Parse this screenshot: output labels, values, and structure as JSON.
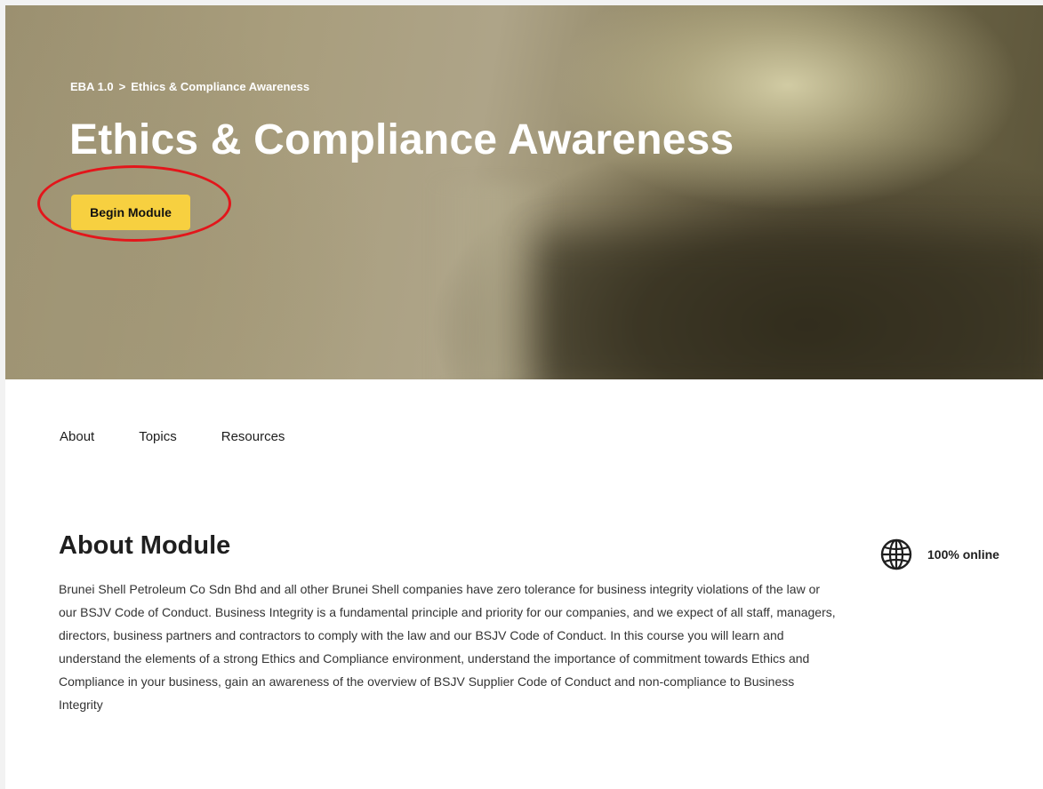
{
  "breadcrumb": {
    "root": "EBA 1.0",
    "separator": ">",
    "current": "Ethics & Compliance Awareness"
  },
  "hero": {
    "title": "Ethics & Compliance Awareness",
    "cta_label": "Begin Module"
  },
  "tabs": [
    {
      "label": "About"
    },
    {
      "label": "Topics"
    },
    {
      "label": "Resources"
    }
  ],
  "about": {
    "heading": "About Module",
    "body": "Brunei Shell Petroleum Co Sdn Bhd and all other Brunei Shell companies have zero tolerance for business integrity violations of the law or our BSJV Code of Conduct. Business Integrity is a fundamental principle and priority for our companies, and we expect of all staff, managers, directors, business partners and contractors to comply with the law and our BSJV Code of Conduct. In this course you will learn and understand the elements of a strong Ethics and Compliance environment, understand the importance of commitment towards Ethics and Compliance in your business, gain an awareness of the overview of BSJV Supplier Code of Conduct and non-compliance to Business Integrity"
  },
  "delivery": {
    "icon": "globe-icon",
    "label": "100% online"
  },
  "colors": {
    "cta_background": "#f7d040",
    "highlight_ring": "#e3161b"
  }
}
